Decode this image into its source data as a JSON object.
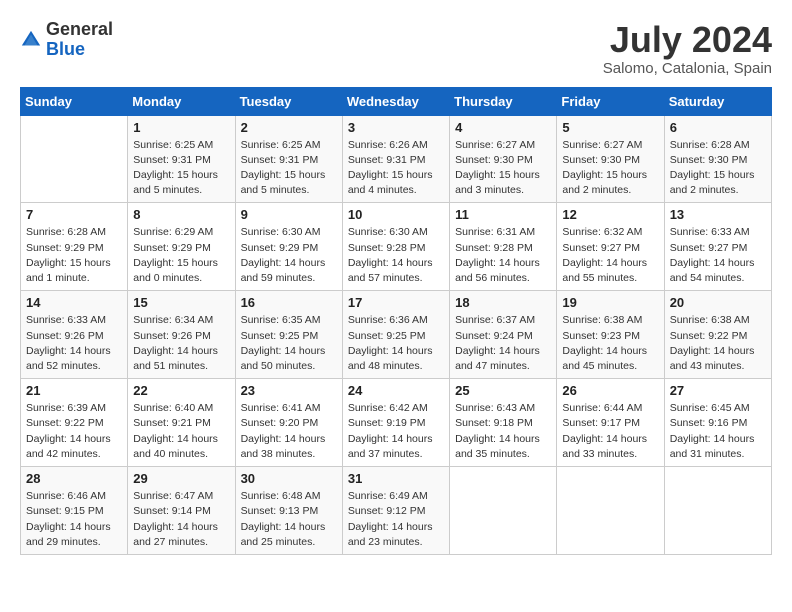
{
  "header": {
    "logo_general": "General",
    "logo_blue": "Blue",
    "month_year": "July 2024",
    "location": "Salomo, Catalonia, Spain"
  },
  "days_of_week": [
    "Sunday",
    "Monday",
    "Tuesday",
    "Wednesday",
    "Thursday",
    "Friday",
    "Saturday"
  ],
  "weeks": [
    [
      {
        "day": "",
        "info": ""
      },
      {
        "day": "1",
        "info": "Sunrise: 6:25 AM\nSunset: 9:31 PM\nDaylight: 15 hours\nand 5 minutes."
      },
      {
        "day": "2",
        "info": "Sunrise: 6:25 AM\nSunset: 9:31 PM\nDaylight: 15 hours\nand 5 minutes."
      },
      {
        "day": "3",
        "info": "Sunrise: 6:26 AM\nSunset: 9:31 PM\nDaylight: 15 hours\nand 4 minutes."
      },
      {
        "day": "4",
        "info": "Sunrise: 6:27 AM\nSunset: 9:30 PM\nDaylight: 15 hours\nand 3 minutes."
      },
      {
        "day": "5",
        "info": "Sunrise: 6:27 AM\nSunset: 9:30 PM\nDaylight: 15 hours\nand 2 minutes."
      },
      {
        "day": "6",
        "info": "Sunrise: 6:28 AM\nSunset: 9:30 PM\nDaylight: 15 hours\nand 2 minutes."
      }
    ],
    [
      {
        "day": "7",
        "info": "Sunrise: 6:28 AM\nSunset: 9:29 PM\nDaylight: 15 hours\nand 1 minute."
      },
      {
        "day": "8",
        "info": "Sunrise: 6:29 AM\nSunset: 9:29 PM\nDaylight: 15 hours\nand 0 minutes."
      },
      {
        "day": "9",
        "info": "Sunrise: 6:30 AM\nSunset: 9:29 PM\nDaylight: 14 hours\nand 59 minutes."
      },
      {
        "day": "10",
        "info": "Sunrise: 6:30 AM\nSunset: 9:28 PM\nDaylight: 14 hours\nand 57 minutes."
      },
      {
        "day": "11",
        "info": "Sunrise: 6:31 AM\nSunset: 9:28 PM\nDaylight: 14 hours\nand 56 minutes."
      },
      {
        "day": "12",
        "info": "Sunrise: 6:32 AM\nSunset: 9:27 PM\nDaylight: 14 hours\nand 55 minutes."
      },
      {
        "day": "13",
        "info": "Sunrise: 6:33 AM\nSunset: 9:27 PM\nDaylight: 14 hours\nand 54 minutes."
      }
    ],
    [
      {
        "day": "14",
        "info": "Sunrise: 6:33 AM\nSunset: 9:26 PM\nDaylight: 14 hours\nand 52 minutes."
      },
      {
        "day": "15",
        "info": "Sunrise: 6:34 AM\nSunset: 9:26 PM\nDaylight: 14 hours\nand 51 minutes."
      },
      {
        "day": "16",
        "info": "Sunrise: 6:35 AM\nSunset: 9:25 PM\nDaylight: 14 hours\nand 50 minutes."
      },
      {
        "day": "17",
        "info": "Sunrise: 6:36 AM\nSunset: 9:25 PM\nDaylight: 14 hours\nand 48 minutes."
      },
      {
        "day": "18",
        "info": "Sunrise: 6:37 AM\nSunset: 9:24 PM\nDaylight: 14 hours\nand 47 minutes."
      },
      {
        "day": "19",
        "info": "Sunrise: 6:38 AM\nSunset: 9:23 PM\nDaylight: 14 hours\nand 45 minutes."
      },
      {
        "day": "20",
        "info": "Sunrise: 6:38 AM\nSunset: 9:22 PM\nDaylight: 14 hours\nand 43 minutes."
      }
    ],
    [
      {
        "day": "21",
        "info": "Sunrise: 6:39 AM\nSunset: 9:22 PM\nDaylight: 14 hours\nand 42 minutes."
      },
      {
        "day": "22",
        "info": "Sunrise: 6:40 AM\nSunset: 9:21 PM\nDaylight: 14 hours\nand 40 minutes."
      },
      {
        "day": "23",
        "info": "Sunrise: 6:41 AM\nSunset: 9:20 PM\nDaylight: 14 hours\nand 38 minutes."
      },
      {
        "day": "24",
        "info": "Sunrise: 6:42 AM\nSunset: 9:19 PM\nDaylight: 14 hours\nand 37 minutes."
      },
      {
        "day": "25",
        "info": "Sunrise: 6:43 AM\nSunset: 9:18 PM\nDaylight: 14 hours\nand 35 minutes."
      },
      {
        "day": "26",
        "info": "Sunrise: 6:44 AM\nSunset: 9:17 PM\nDaylight: 14 hours\nand 33 minutes."
      },
      {
        "day": "27",
        "info": "Sunrise: 6:45 AM\nSunset: 9:16 PM\nDaylight: 14 hours\nand 31 minutes."
      }
    ],
    [
      {
        "day": "28",
        "info": "Sunrise: 6:46 AM\nSunset: 9:15 PM\nDaylight: 14 hours\nand 29 minutes."
      },
      {
        "day": "29",
        "info": "Sunrise: 6:47 AM\nSunset: 9:14 PM\nDaylight: 14 hours\nand 27 minutes."
      },
      {
        "day": "30",
        "info": "Sunrise: 6:48 AM\nSunset: 9:13 PM\nDaylight: 14 hours\nand 25 minutes."
      },
      {
        "day": "31",
        "info": "Sunrise: 6:49 AM\nSunset: 9:12 PM\nDaylight: 14 hours\nand 23 minutes."
      },
      {
        "day": "",
        "info": ""
      },
      {
        "day": "",
        "info": ""
      },
      {
        "day": "",
        "info": ""
      }
    ]
  ]
}
